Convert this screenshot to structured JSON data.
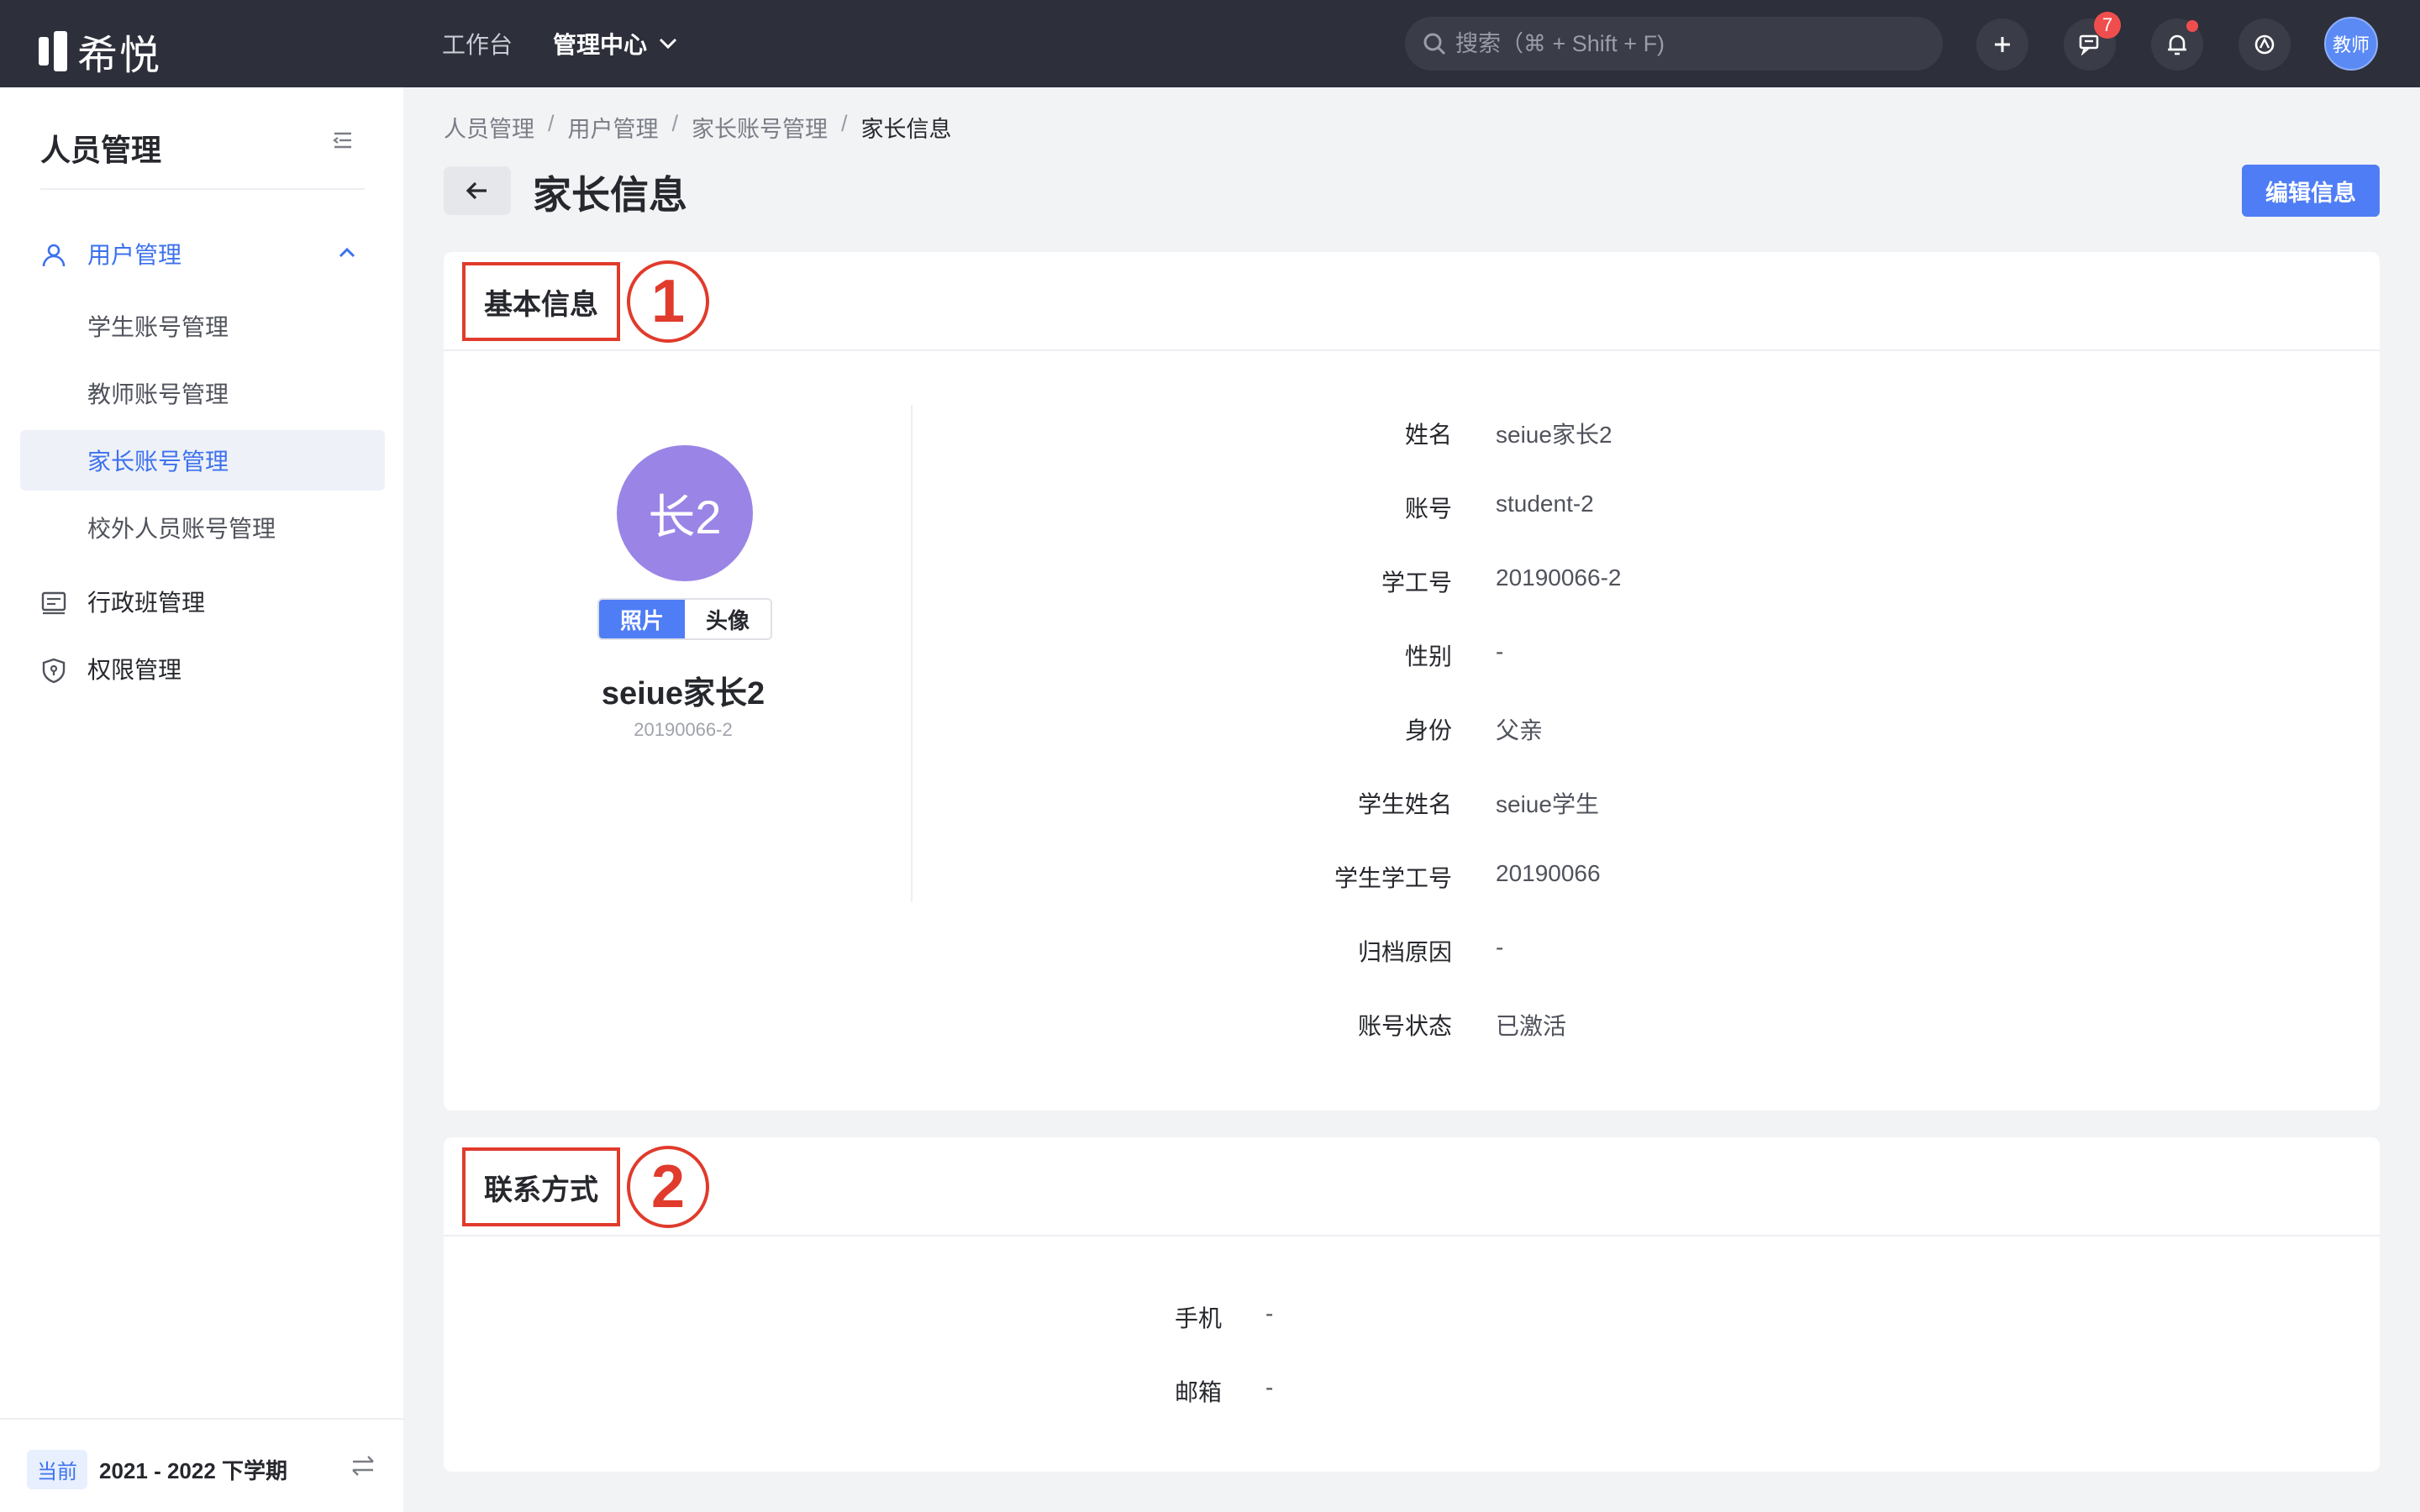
{
  "app": {
    "logo_text": "希悦"
  },
  "topnav": {
    "workbench": "工作台",
    "admin_center": "管理中心",
    "search_placeholder": "搜索（⌘ + Shift + F)",
    "message_count": "7",
    "user_label": "教师"
  },
  "sidebar": {
    "title": "人员管理",
    "user_mgmt": "用户管理",
    "sub_items": [
      "学生账号管理",
      "教师账号管理",
      "家长账号管理",
      "校外人员账号管理"
    ],
    "class_mgmt": "行政班管理",
    "perm_mgmt": "权限管理",
    "term_tag": "当前",
    "term_text": "2021 - 2022 下学期"
  },
  "breadcrumb": [
    "人员管理",
    "用户管理",
    "家长账号管理",
    "家长信息"
  ],
  "page": {
    "title": "家长信息",
    "edit_button": "编辑信息"
  },
  "section1": {
    "title": "基本信息",
    "marker": "①",
    "avatar_text": "长2",
    "photo_tab": "照片",
    "avatar_tab": "头像",
    "name": "seiue家长2",
    "id": "20190066-2",
    "fields": [
      {
        "k": "姓名",
        "v": "seiue家长2"
      },
      {
        "k": "账号",
        "v": "student-2"
      },
      {
        "k": "学工号",
        "v": "20190066-2"
      },
      {
        "k": "性别",
        "v": "-"
      },
      {
        "k": "身份",
        "v": "父亲"
      },
      {
        "k": "学生姓名",
        "v": "seiue学生"
      },
      {
        "k": "学生学工号",
        "v": "20190066"
      },
      {
        "k": "归档原因",
        "v": "-"
      },
      {
        "k": "账号状态",
        "v": "已激活"
      }
    ]
  },
  "section2": {
    "title": "联系方式",
    "marker": "②",
    "fields": [
      {
        "k": "手机",
        "v": "-"
      },
      {
        "k": "邮箱",
        "v": "-"
      }
    ]
  },
  "colors": {
    "topbar": "#2d2f3b",
    "accent": "#4f7df5",
    "annotation_red": "#e03b2c",
    "avatar_purple": "#9a84e6"
  }
}
